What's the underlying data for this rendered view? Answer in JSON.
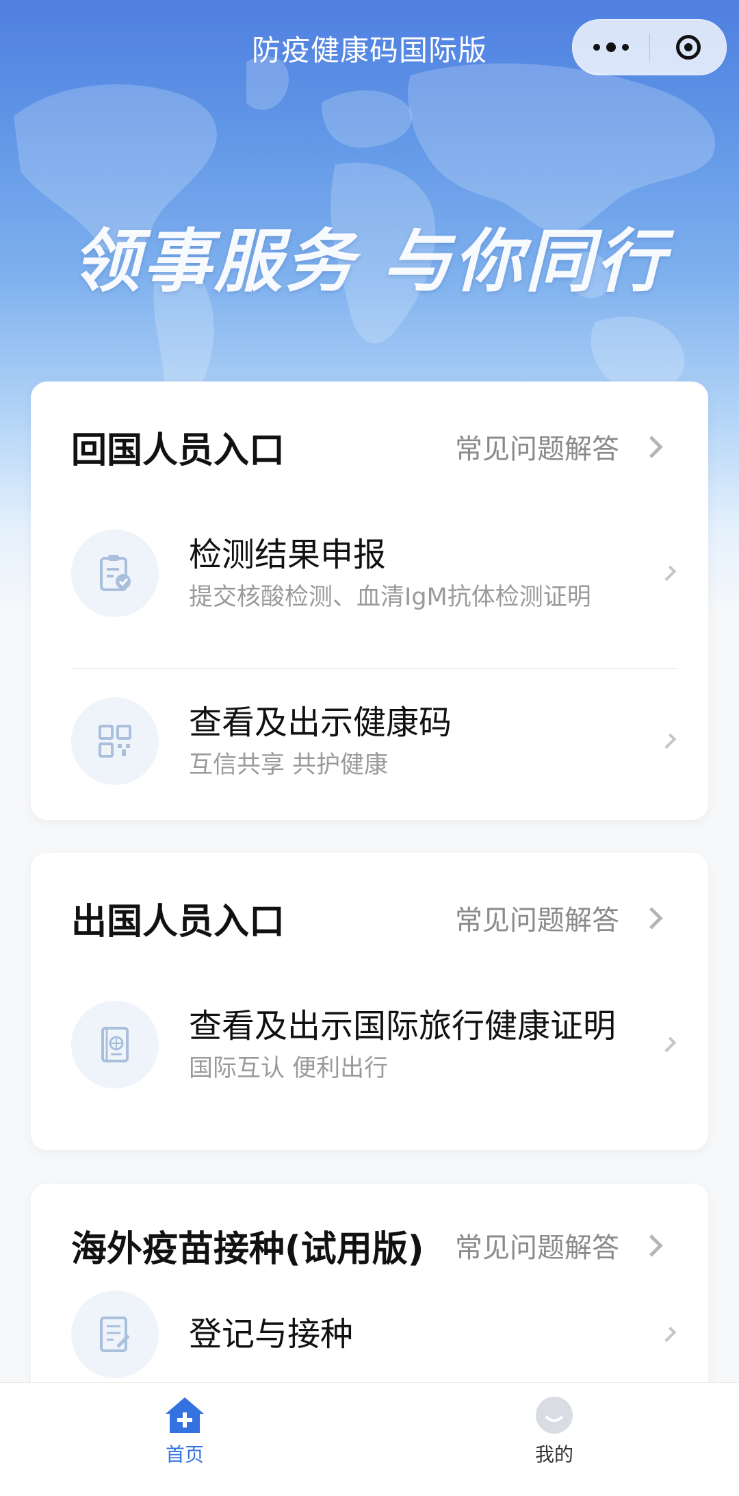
{
  "header": {
    "title": "防疫健康码国际版",
    "slogan": "领事服务 与你同行"
  },
  "sections": [
    {
      "title": "回国人员入口",
      "faq": "常见问题解答",
      "items": [
        {
          "title": "检测结果申报",
          "subtitle": "提交核酸检测、血清IgM抗体检测证明",
          "icon": "clipboard-check-icon"
        },
        {
          "title": "查看及出示健康码",
          "subtitle": "互信共享 共护健康",
          "icon": "qr-code-icon"
        }
      ]
    },
    {
      "title": "出国人员入口",
      "faq": "常见问题解答",
      "items": [
        {
          "title": "查看及出示国际旅行健康证明",
          "subtitle": "国际互认 便利出行",
          "icon": "passport-icon"
        }
      ]
    },
    {
      "title": "海外疫苗接种(试用版)",
      "faq": "常见问题解答",
      "items": [
        {
          "title": "登记与接种",
          "subtitle": "",
          "icon": "document-edit-icon"
        }
      ]
    }
  ],
  "tabbar": {
    "home": "首页",
    "mine": "我的"
  },
  "colors": {
    "accent": "#3472e0",
    "icon_tint": "#a9bfdc"
  }
}
